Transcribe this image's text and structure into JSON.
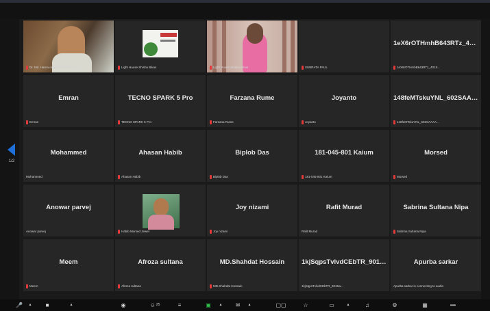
{
  "tiles": [
    {
      "label": "Dr. Md. Harun-or-Rashid, PhD (Chief)",
      "center": ""
    },
    {
      "label": "Light House Shishu Bikas",
      "center": ""
    },
    {
      "label": "Light House Shishu Bikas",
      "center": ""
    },
    {
      "label": "SUBRATA PAUL",
      "center": ""
    },
    {
      "label": "1eX6rOTHmhB643RTz_401S...",
      "center": "1eX6rOTHmhB643RTz_401S..."
    },
    {
      "label": "Emran",
      "center": "Emran"
    },
    {
      "label": "TECNO SPARK 5 Pro",
      "center": "TECNO SPARK 5 Pro"
    },
    {
      "label": "Farzana Rume",
      "center": "Farzana Rume"
    },
    {
      "label": "Joyanto",
      "center": "Joyanto"
    },
    {
      "label": "148feMTskuYNL_602SAAAA...",
      "center": "148feMTskuYNL_602SAAAA..."
    },
    {
      "label": "Mohammed",
      "center": "Mohammed"
    },
    {
      "label": "Ahasan Habib",
      "center": "Ahasan Habib"
    },
    {
      "label": "Biplob Das",
      "center": "Biplob Das"
    },
    {
      "label": "181-045-801 Kaium",
      "center": "181-045-801 Kaium"
    },
    {
      "label": "Morsed",
      "center": "Morsed"
    },
    {
      "label": "Anowar parvej",
      "center": "Anowar parvej"
    },
    {
      "label": "Habib Morsed Jewel",
      "center": ""
    },
    {
      "label": "Joy nizami",
      "center": "Joy nizami"
    },
    {
      "label": "Rafit Murad",
      "center": "Rafit Murad"
    },
    {
      "label": "Sabrina Sultana Nipa",
      "center": "Sabrina Sultana Nipa"
    },
    {
      "label": "Meem",
      "center": "Meem"
    },
    {
      "label": "Afroza sultana",
      "center": "Afroza sultana"
    },
    {
      "label": "MD.Shahdat Hossain",
      "center": "MD.Shahdat Hossain"
    },
    {
      "label": "1kjSqpsTvlvdCEbTR_9015w...",
      "center": "1kjSqpsTvlvdCEbTR_9015w..."
    },
    {
      "label": "Apurba sarkar is connecting to audio",
      "center": "Apurba sarkar"
    }
  ],
  "pager": {
    "page": "1/2"
  },
  "toolbar": {
    "participants_count": "25"
  },
  "colors": {
    "active_speaker": "#c6d23a",
    "muted_mic": "#e03a3a",
    "pager_arrow": "#1e6fd8"
  }
}
